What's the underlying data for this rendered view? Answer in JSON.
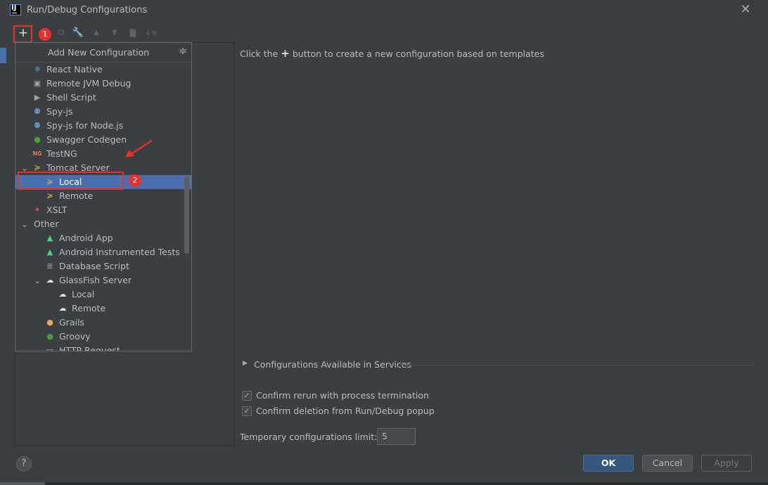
{
  "window": {
    "title": "Run/Debug Configurations"
  },
  "toolbar": {
    "add_label": "+",
    "copy_label": "⧉",
    "wrench_label": "🔧",
    "up_label": "▲",
    "down_label": "▼",
    "folder_label": "▇",
    "sort_label": "↓≡"
  },
  "annotations": {
    "badge1": "1",
    "badge2": "2"
  },
  "popup": {
    "title": "Add New Configuration",
    "items": [
      {
        "label": "React Native",
        "icon": "react-icon",
        "glyph": "⚛",
        "color": "#61dafb"
      },
      {
        "label": "Remote JVM Debug",
        "icon": "remote-debug-icon",
        "glyph": "▣",
        "color": "#9aa7b0"
      },
      {
        "label": "Shell Script",
        "icon": "shell-script-icon",
        "glyph": "▶",
        "color": "#9aa7b0"
      },
      {
        "label": "Spy-js",
        "icon": "spyjs-icon",
        "glyph": "⚉",
        "color": "#6897bb"
      },
      {
        "label": "Spy-js for Node.js",
        "icon": "spyjs-node-icon",
        "glyph": "⚉",
        "color": "#6897bb"
      },
      {
        "label": "Swagger Codegen",
        "icon": "swagger-icon",
        "glyph": "●",
        "color": "#49a03a"
      },
      {
        "label": "TestNG",
        "icon": "testng-icon",
        "glyph": "NG",
        "color": "#e0785a"
      },
      {
        "label": "Tomcat Server",
        "icon": "tomcat-icon",
        "glyph": "≽",
        "color": "#f2b53c"
      },
      {
        "label": "Local",
        "icon": "tomcat-local-icon",
        "glyph": "≽",
        "color": "#f2b53c"
      },
      {
        "label": "Remote",
        "icon": "tomcat-remote-icon",
        "glyph": "≽",
        "color": "#f2b53c"
      },
      {
        "label": "XSLT",
        "icon": "xslt-icon",
        "glyph": "✦",
        "color": "#c75450"
      },
      {
        "label": "Other",
        "icon": "",
        "glyph": "",
        "color": ""
      },
      {
        "label": "Android App",
        "icon": "android-icon",
        "glyph": "▲",
        "color": "#3ddc84"
      },
      {
        "label": "Android Instrumented Tests",
        "icon": "android-test-icon",
        "glyph": "▲",
        "color": "#3ddc84"
      },
      {
        "label": "Database Script",
        "icon": "database-icon",
        "glyph": "≣",
        "color": "#9aa7b0"
      },
      {
        "label": "GlassFish Server",
        "icon": "glassfish-icon",
        "glyph": "☁",
        "color": "#dfe1e5"
      },
      {
        "label": "Local",
        "icon": "glassfish-local-icon",
        "glyph": "☁",
        "color": "#dfe1e5"
      },
      {
        "label": "Remote",
        "icon": "glassfish-remote-icon",
        "glyph": "☁",
        "color": "#dfe1e5"
      },
      {
        "label": "Grails",
        "icon": "grails-icon",
        "glyph": "●",
        "color": "#e8a85b"
      },
      {
        "label": "Groovy",
        "icon": "groovy-icon",
        "glyph": "●",
        "color": "#49a03a"
      },
      {
        "label": "HTTP Request",
        "icon": "http-request-icon",
        "glyph": "▭",
        "color": "#9aa7b0"
      }
    ]
  },
  "main": {
    "hint_before": "Click the",
    "hint_plus": "+",
    "hint_after": "button to create a new configuration based on templates",
    "services_label": "Configurations Available in Services",
    "confirm_rerun_label": "Confirm rerun with process termination",
    "confirm_rerun_checked": true,
    "confirm_delete_label": "Confirm deletion from Run/Debug popup",
    "confirm_delete_checked": true,
    "temp_limit_label": "Temporary configurations limit:",
    "temp_limit_value": "5"
  },
  "footer": {
    "help_label": "?",
    "ok_label": "OK",
    "cancel_label": "Cancel",
    "apply_label": "Apply"
  },
  "colors": {
    "background": "#3c3f41",
    "selection": "#4b6eaf",
    "ok_button": "#365880",
    "annotation_red": "#e8302f"
  }
}
